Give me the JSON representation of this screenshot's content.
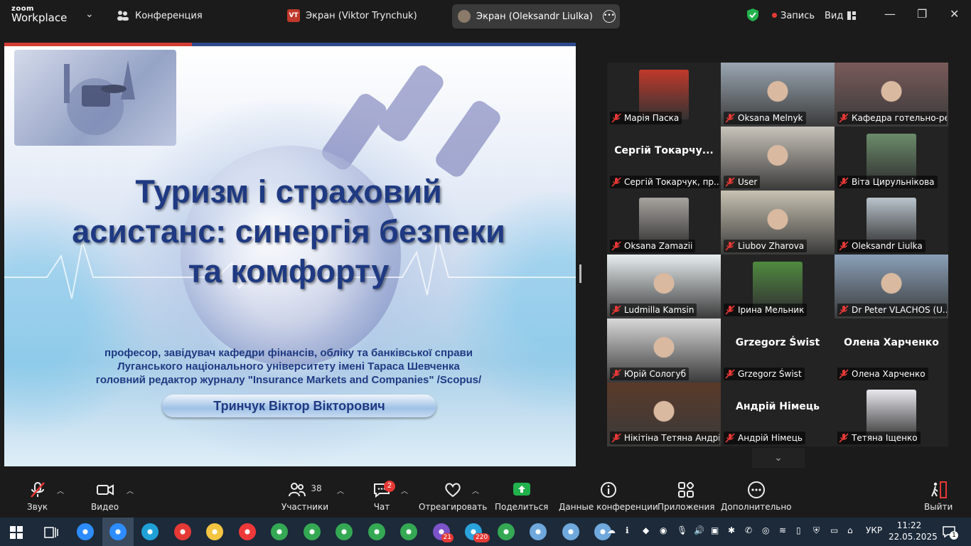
{
  "titlebar": {
    "logo_top": "zoom",
    "logo_bottom": "Workplace",
    "conference_label": "Конференция",
    "screen1_initials": "VT",
    "screen1_label": "Экран (Viktor Trynchuk)",
    "screen2_label": "Экран (Oleksandr Liulka)",
    "record_label": "Запись",
    "view_label": "Вид"
  },
  "slide": {
    "title_lines": [
      "Туризм і страховий",
      "асистанс: синергія безпеки",
      "та комфорту"
    ],
    "subtitle_lines": [
      "професор, завідувач  кафедри фінансів, обліку та банківської справи",
      "Луганського національного університету імені Тараса Шевченка",
      "головний редактор журналу \"Insurance Markets and Companies\" /Scopus/"
    ],
    "presenter": "Тринчук Віктор Вікторович"
  },
  "participants": [
    {
      "label": "Марія Паска",
      "kind": "photo",
      "color": "#c0392b"
    },
    {
      "label": "Oksana Melnyk",
      "kind": "video",
      "color": "#9aa6b2"
    },
    {
      "label": "Кафедра готельно-рест...",
      "kind": "video",
      "color": "#7a5a5a",
      "highlight": true
    },
    {
      "label": "Сергій Токарчук, пр...",
      "kind": "name",
      "big": "Сергій  Токарчу..."
    },
    {
      "label": "User",
      "kind": "video",
      "color": "#c9c4bb"
    },
    {
      "label": "Віта Цирульнікова",
      "kind": "photo",
      "color": "#6b8c6a"
    },
    {
      "label": "Oksana Zamazii",
      "kind": "photo",
      "color": "#a7a39e"
    },
    {
      "label": "Liubov Zharova",
      "kind": "video",
      "color": "#c8c2b2"
    },
    {
      "label": "Oleksandr Liulka",
      "kind": "photo",
      "color": "#b9c3cc"
    },
    {
      "label": "Ludmilla Kamsin",
      "kind": "video",
      "color": "#e8eef0"
    },
    {
      "label": "Ірина Мельник",
      "kind": "photo",
      "color": "#4f8a3f"
    },
    {
      "label": "Dr Peter VLACHOS (U...",
      "kind": "video",
      "color": "#8aa0b8"
    },
    {
      "label": "Юрій Сологуб",
      "kind": "video",
      "color": "#d8d8d8"
    },
    {
      "label": "Grzegorz Świst",
      "kind": "name",
      "big": "Grzegorz Świst"
    },
    {
      "label": "Олена Харченко",
      "kind": "name",
      "big": "Олена Харченко"
    },
    {
      "label": "Нікітіна Тетяна Андрі...",
      "kind": "video",
      "color": "#5a3a2a"
    },
    {
      "label": "Андрій Німець",
      "kind": "name",
      "big": "Андрій Німець"
    },
    {
      "label": "Тетяна Іщенко",
      "kind": "photo",
      "color": "#e8e8ee"
    }
  ],
  "toolbar": {
    "audio": "Звук",
    "video": "Видео",
    "participants": "Участники",
    "participants_count": "38",
    "chat": "Чат",
    "chat_badge": "2",
    "react": "Отреагировать",
    "share": "Поделиться",
    "info": "Данные конференции",
    "apps": "Приложения",
    "more": "Дополнительно",
    "leave": "Выйти"
  },
  "taskbar": {
    "apps": [
      {
        "icon": "zoom-icon",
        "color": "#2d8cff"
      },
      {
        "icon": "zoom-workplace-icon",
        "color": "#2d8cff"
      },
      {
        "icon": "edge-icon",
        "color": "#1fa1d8"
      },
      {
        "icon": "yandex-browser-icon",
        "color": "#e53935"
      },
      {
        "icon": "file-explorer-icon",
        "color": "#f4c542"
      },
      {
        "icon": "vivaldi-icon",
        "color": "#ef3939"
      },
      {
        "icon": "chrome-icon",
        "color": "#34a853"
      },
      {
        "icon": "chrome-profile-p-icon",
        "color": "#34a853"
      },
      {
        "icon": "chrome-profile-2-icon",
        "color": "#34a853"
      },
      {
        "icon": "chrome-profile-m-icon",
        "color": "#34a853"
      },
      {
        "icon": "chrome-profile-3-icon",
        "color": "#34a853"
      },
      {
        "icon": "viber-icon",
        "color": "#7d53c8"
      },
      {
        "icon": "telegram-icon",
        "color": "#2aa3dc"
      },
      {
        "icon": "chrome-profile-4-icon",
        "color": "#34a853"
      },
      {
        "icon": "paint-icon",
        "color": "#6fa8dc"
      },
      {
        "icon": "paint-2-icon",
        "color": "#6fa8dc"
      },
      {
        "icon": "paint-3-icon",
        "color": "#6fa8dc"
      }
    ],
    "viber_badge": "21",
    "telegram_badge": "220",
    "language": "УКР",
    "time": "11:22",
    "date": "22.05.2025",
    "notification_count": "1"
  }
}
